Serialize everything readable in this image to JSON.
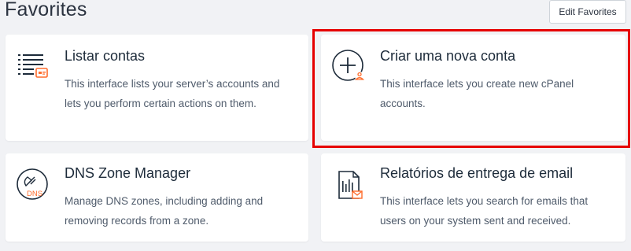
{
  "page": {
    "title": "Favorites",
    "edit_button_label": "Edit Favorites"
  },
  "favorites": [
    {
      "title": "Listar contas",
      "description": "This interface lists your server’s accounts and lets you perform certain actions on them.",
      "icon": "list-accounts-icon"
    },
    {
      "title": "Criar uma nova conta",
      "description": "This interface lets you create new cPanel accounts.",
      "icon": "create-account-icon"
    },
    {
      "title": "DNS Zone Manager",
      "description": "Manage DNS zones, including adding and removing records from a zone.",
      "icon": "dns-zone-icon",
      "icon_text": "DNS"
    },
    {
      "title": "Relatórios de entrega de email",
      "description": "This interface lets you search for emails that users on your system sent and received.",
      "icon": "email-delivery-report-icon"
    }
  ],
  "colors": {
    "accent": "#ff6c2c",
    "icon_dark": "#1d2b3a",
    "highlight": "#e60000",
    "background": "#f1f2f5"
  }
}
